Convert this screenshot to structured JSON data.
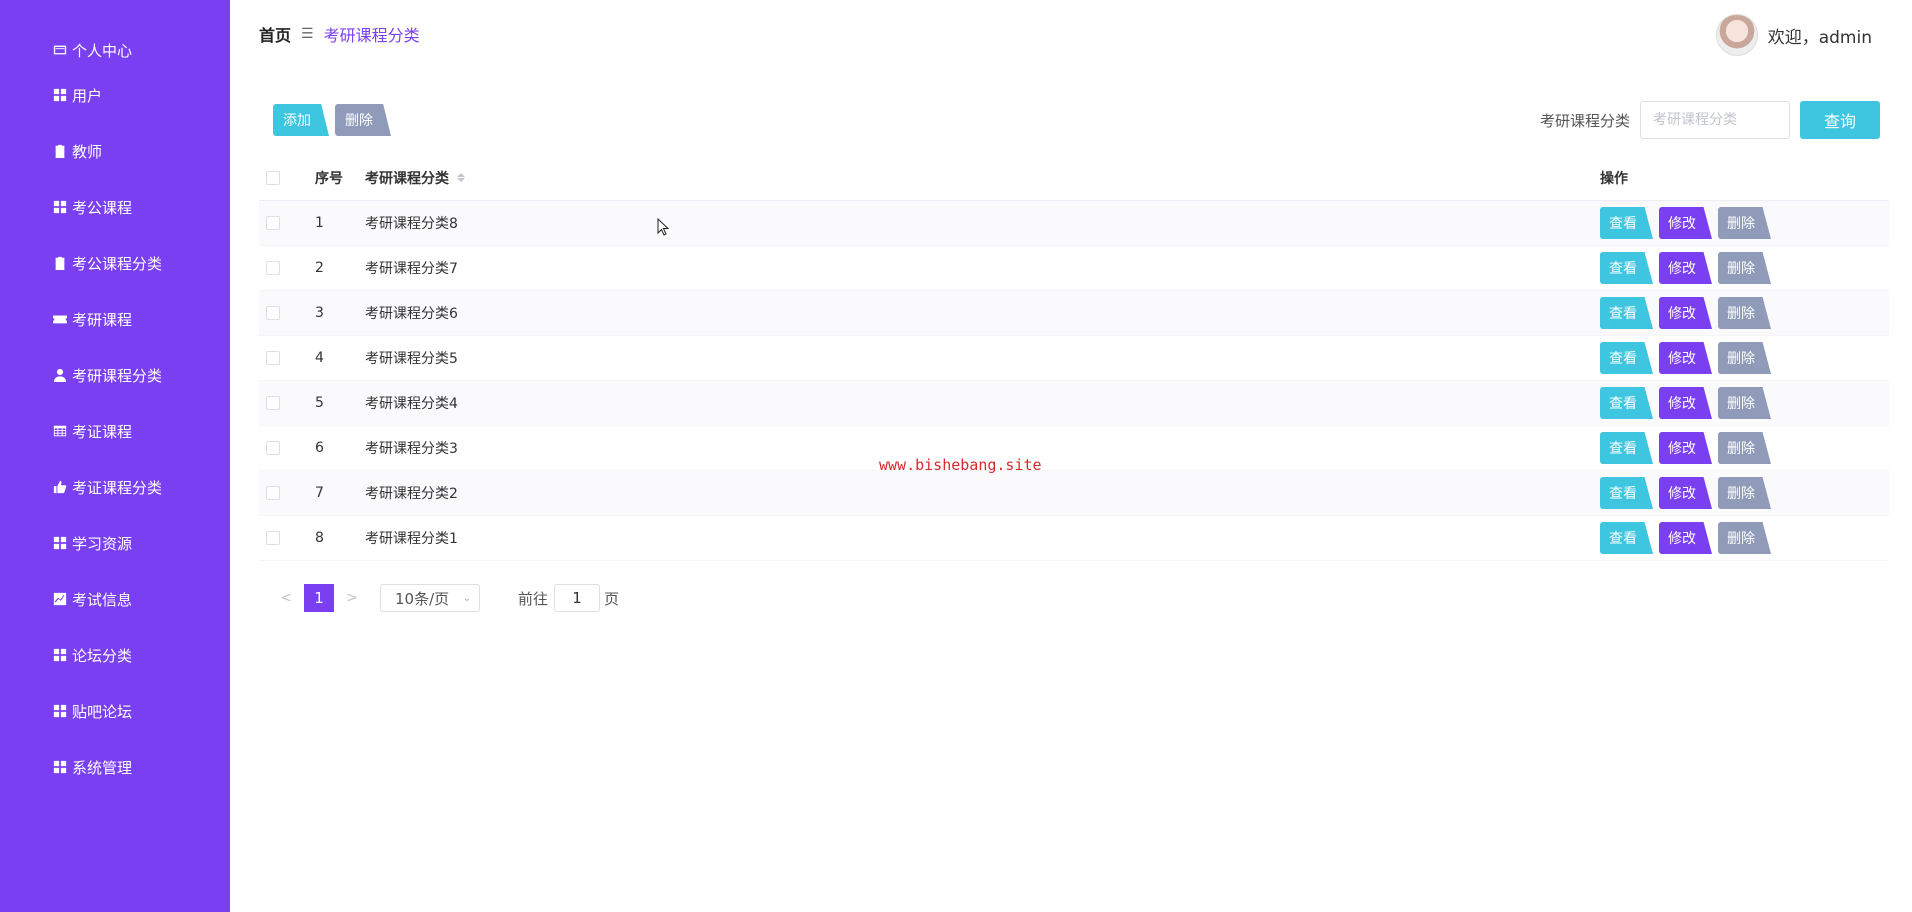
{
  "sidebar": {
    "items": [
      {
        "label": "个人中心",
        "icon": "id-card-icon"
      },
      {
        "label": "用户",
        "icon": "grid-icon"
      },
      {
        "label": "教师",
        "icon": "clipboard-icon"
      },
      {
        "label": "考公课程",
        "icon": "grid-icon"
      },
      {
        "label": "考公课程分类",
        "icon": "clipboard-icon"
      },
      {
        "label": "考研课程",
        "icon": "ticket-icon"
      },
      {
        "label": "考研课程分类",
        "icon": "person-icon"
      },
      {
        "label": "考证课程",
        "icon": "table-icon"
      },
      {
        "label": "考证课程分类",
        "icon": "thumb-icon"
      },
      {
        "label": "学习资源",
        "icon": "grid-icon"
      },
      {
        "label": "考试信息",
        "icon": "chart-icon"
      },
      {
        "label": "论坛分类",
        "icon": "grid-icon"
      },
      {
        "label": "贴吧论坛",
        "icon": "grid-icon"
      },
      {
        "label": "系统管理",
        "icon": "grid-icon"
      }
    ]
  },
  "header": {
    "breadcrumb_home": "首页",
    "breadcrumb_sep": "☰",
    "breadcrumb_current": "考研课程分类",
    "welcome": "欢迎，admin"
  },
  "toolbar": {
    "add_label": "添加",
    "delete_label": "删除",
    "search_label": "考研课程分类",
    "search_placeholder": "考研课程分类",
    "query_label": "查询"
  },
  "table": {
    "headers": {
      "index": "序号",
      "name": "考研课程分类",
      "ops": "操作"
    },
    "rows": [
      {
        "index": "1",
        "name": "考研课程分类8"
      },
      {
        "index": "2",
        "name": "考研课程分类7"
      },
      {
        "index": "3",
        "name": "考研课程分类6"
      },
      {
        "index": "4",
        "name": "考研课程分类5"
      },
      {
        "index": "5",
        "name": "考研课程分类4"
      },
      {
        "index": "6",
        "name": "考研课程分类3"
      },
      {
        "index": "7",
        "name": "考研课程分类2"
      },
      {
        "index": "8",
        "name": "考研课程分类1"
      }
    ],
    "op_view": "查看",
    "op_edit": "修改",
    "op_delete": "删除"
  },
  "pagination": {
    "prev": "<",
    "current_page": "1",
    "next": ">",
    "page_size": "10条/页",
    "goto_label": "前往",
    "goto_value": "1",
    "page_suffix": "页"
  },
  "watermark": "www.bishebang.site",
  "colors": {
    "sidebar_bg": "#7b3ff2",
    "accent_cyan": "#3ec6e0",
    "accent_purple": "#7b3ff2",
    "muted_gray": "#8f9bb8"
  }
}
